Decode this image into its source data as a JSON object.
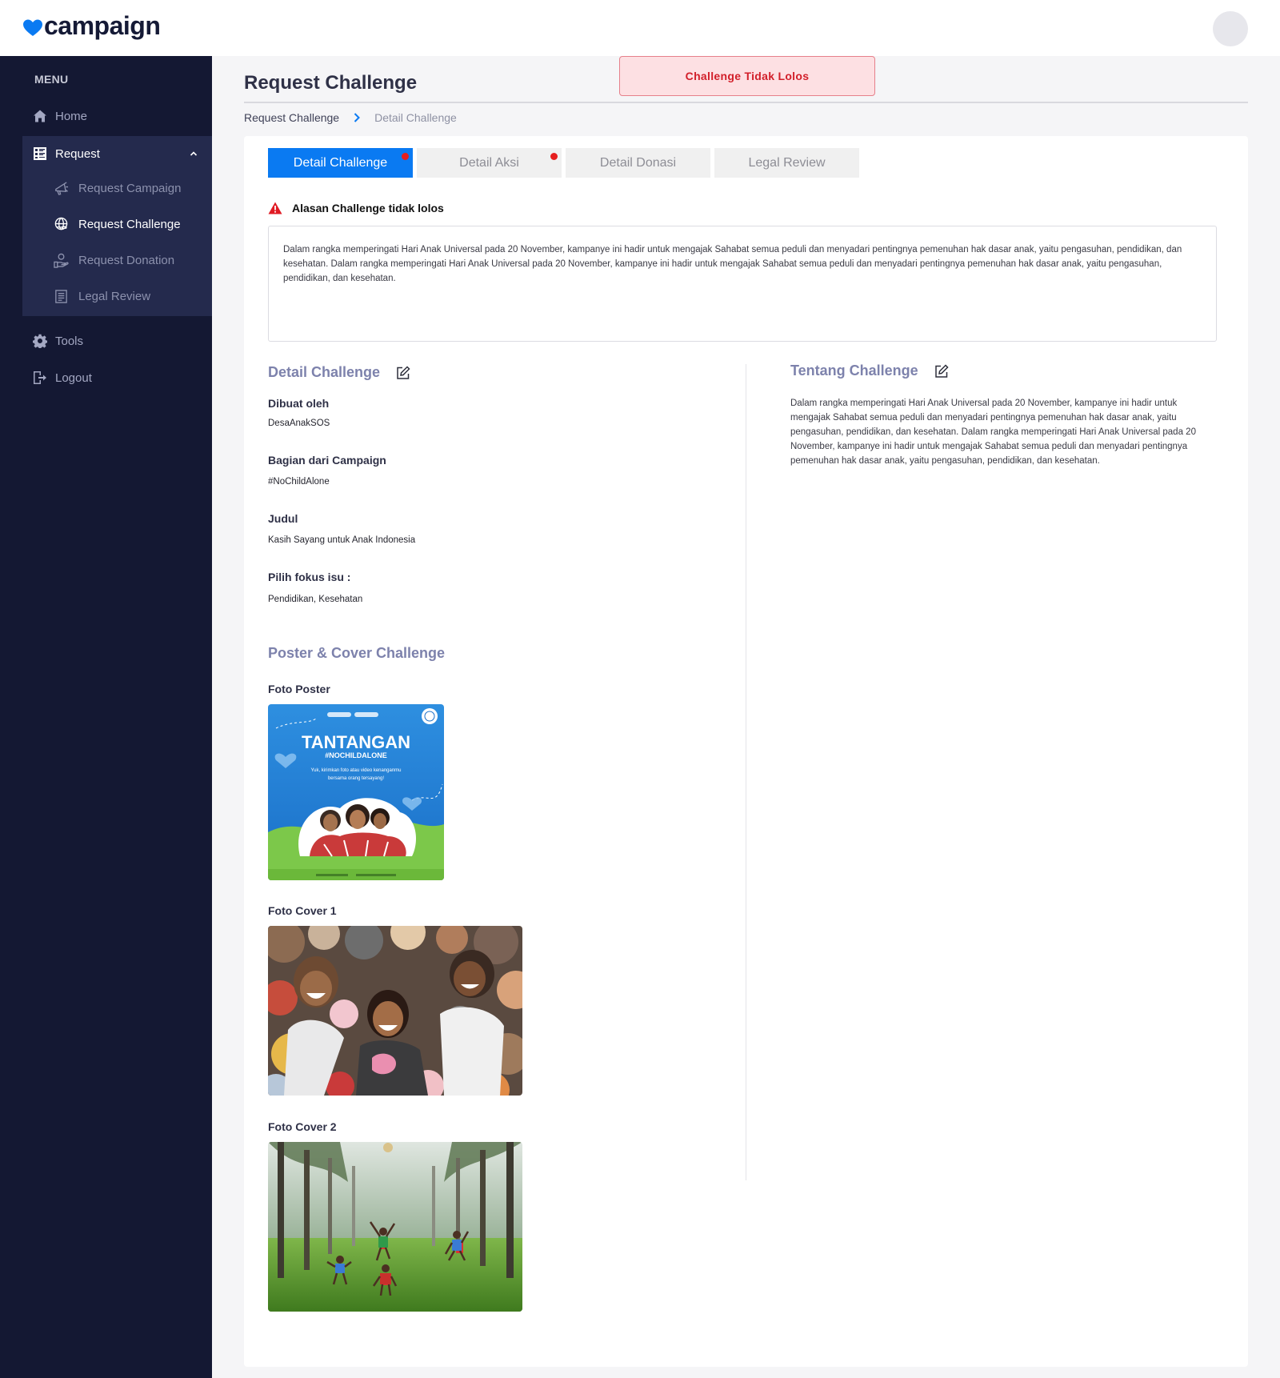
{
  "header": {
    "logo_text": "campaign",
    "brand_color": "#0a7af2"
  },
  "sidebar": {
    "menu_title": "MENU",
    "items": [
      {
        "label": "Home",
        "icon": "home-icon"
      },
      {
        "label": "Request",
        "icon": "document-grid-icon",
        "expanded": true,
        "children": [
          {
            "label": "Request Campaign",
            "icon": "megaphone-icon"
          },
          {
            "label": "Request Challenge",
            "icon": "globe-hand-icon",
            "active": true
          },
          {
            "label": "Request Donation",
            "icon": "donation-hand-icon"
          },
          {
            "label": "Legal Review",
            "icon": "document-lines-icon"
          }
        ]
      },
      {
        "label": "Tools",
        "icon": "gear-icon"
      },
      {
        "label": "Logout",
        "icon": "logout-icon"
      }
    ]
  },
  "page": {
    "title": "Request Challenge",
    "status": "Challenge Tidak Lolos",
    "breadcrumb": [
      "Request Challenge",
      "Detail Challenge"
    ]
  },
  "tabs": [
    {
      "label": "Detail Challenge",
      "active": true,
      "has_dot": true
    },
    {
      "label": "Detail Aksi",
      "active": false,
      "has_dot": true
    },
    {
      "label": "Detail Donasi",
      "active": false,
      "has_dot": false
    },
    {
      "label": "Legal Review",
      "active": false,
      "has_dot": false
    }
  ],
  "rejection": {
    "title": "Alasan Challenge tidak lolos",
    "text": "Dalam rangka memperingati Hari Anak Universal pada 20 November, kampanye ini hadir untuk mengajak Sahabat semua peduli dan menyadari pentingnya pemenuhan hak dasar anak, yaitu pengasuhan, pendidikan, dan kesehatan. Dalam rangka memperingati Hari Anak Universal pada 20 November, kampanye ini hadir untuk mengajak Sahabat semua peduli dan menyadari pentingnya pemenuhan hak dasar anak, yaitu pengasuhan, pendidikan, dan kesehatan."
  },
  "detail": {
    "section_title": "Detail Challenge",
    "fields": [
      {
        "label": "Dibuat oleh",
        "value": "DesaAnakSOS"
      },
      {
        "label": "Bagian dari Campaign",
        "value": "#NoChildAlone"
      },
      {
        "label": "Judul",
        "value": "Kasih Sayang untuk Anak Indonesia"
      },
      {
        "label": "Pilih fokus isu :",
        "value": "Pendidikan, Kesehatan"
      }
    ]
  },
  "about": {
    "section_title": "Tentang Challenge",
    "text": "Dalam rangka memperingati Hari Anak Universal pada 20 November, kampanye ini hadir untuk mengajak Sahabat semua peduli dan menyadari pentingnya pemenuhan hak dasar anak, yaitu pengasuhan, pendidikan, dan kesehatan. Dalam rangka memperingati Hari Anak Universal pada 20 November, kampanye ini hadir untuk mengajak Sahabat semua peduli dan menyadari pentingnya pemenuhan hak dasar anak, yaitu pengasuhan, pendidikan, dan kesehatan."
  },
  "media": {
    "section_title": "Poster & Cover Challenge",
    "poster_label": "Foto Poster",
    "poster_heading": "TANTANGAN",
    "poster_tag": "#NOCHILDALONE",
    "poster_sub_1": "Yuk, kirimkan foto atau video kenanganmu",
    "poster_sub_2": "bersama orang tersayang!",
    "cover1_label": "Foto Cover 1",
    "cover2_label": "Foto Cover 2"
  }
}
